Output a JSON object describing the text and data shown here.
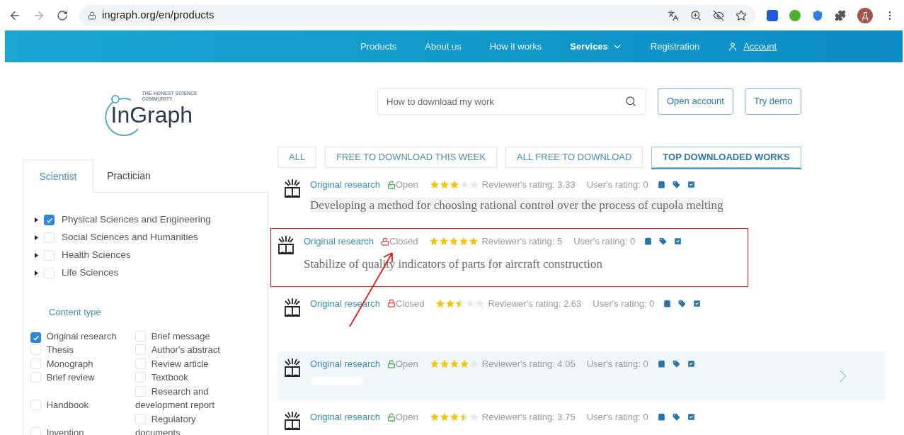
{
  "browser": {
    "url": "ingraph.org/en/products",
    "profile_letter": "Д"
  },
  "nav": {
    "items": [
      {
        "label": "Products",
        "kind": "link",
        "selected": false
      },
      {
        "label": "About us",
        "kind": "link",
        "selected": false
      },
      {
        "label": "How it works",
        "kind": "link",
        "selected": false
      },
      {
        "label": "Services",
        "kind": "dropdown",
        "selected": true
      },
      {
        "label": "Registration",
        "kind": "link",
        "selected": false
      },
      {
        "label": "Account",
        "kind": "account",
        "selected": false
      }
    ]
  },
  "logo": {
    "tagline": "THE HONEST SCIENCE COMMUNITY",
    "name": "InGraph"
  },
  "search": {
    "placeholder": "How to download my work"
  },
  "header_buttons": [
    "Open account",
    "Try demo"
  ],
  "filters": [
    {
      "label": "ALL",
      "selected": false
    },
    {
      "label": "FREE TO DOWNLOAD THIS WEEK",
      "selected": false
    },
    {
      "label": "ALL FREE TO DOWNLOAD",
      "selected": false
    },
    {
      "label": "TOP DOWNLOADED WORKS",
      "selected": true
    }
  ],
  "sidebar": {
    "tabs": [
      {
        "label": "Scientist",
        "selected": true
      },
      {
        "label": "Practician",
        "selected": false
      }
    ],
    "categories": [
      {
        "label": "Physical Sciences and Engineering",
        "checked": true
      },
      {
        "label": "Social Sciences and Humanities",
        "checked": false
      },
      {
        "label": "Health Sciences",
        "checked": false
      },
      {
        "label": "Life Sciences",
        "checked": false
      }
    ],
    "content_type_title": "Content type",
    "content_types": [
      {
        "label": "Original research",
        "checked": true
      },
      {
        "label": "Brief message",
        "checked": false
      },
      {
        "label": "Thesis",
        "checked": false
      },
      {
        "label": "Author's abstract",
        "checked": false
      },
      {
        "label": "Monograph",
        "checked": false
      },
      {
        "label": "Review article",
        "checked": false
      },
      {
        "label": "Brief review",
        "checked": false
      },
      {
        "label": "Textbook",
        "checked": false
      },
      {
        "label": "Handbook",
        "checked": false
      },
      {
        "label": "Research and development report",
        "checked": false
      },
      {
        "label": "Invention",
        "checked": false
      },
      {
        "label": "Regulatory documents",
        "checked": false
      }
    ]
  },
  "works": [
    {
      "type": "Original research",
      "locked": false,
      "access_label": "Open",
      "stars": 3,
      "reviewer_rating": "Reviewer's rating: 3.33",
      "user_rating": "User's rating: 0",
      "title": "Developing a method for choosing rational control over the process of cupola melting",
      "framed": false,
      "hovered": false
    },
    {
      "type": "Original research",
      "locked": true,
      "access_label": "Closed",
      "stars": 5,
      "reviewer_rating": "Reviewer's rating: 5",
      "user_rating": "User's rating: 0",
      "title": "Stabilize of quality indicators of parts for aircraft construction",
      "framed": true,
      "hovered": false
    },
    {
      "type": "Original research",
      "locked": true,
      "access_label": "Closed",
      "stars": 2.5,
      "reviewer_rating": "Reviewer's rating: 2.63",
      "user_rating": "User's rating: 0",
      "framed": false,
      "hovered": false
    },
    {
      "type": "Original research",
      "locked": false,
      "access_label": "Open",
      "stars": 4,
      "reviewer_rating": "Reviewer's rating: 4.05",
      "user_rating": "User's rating: 0",
      "framed": false,
      "hovered": true
    },
    {
      "type": "Original research",
      "locked": false,
      "access_label": "Open",
      "stars": 3.5,
      "reviewer_rating": "Reviewer's rating: 3.75",
      "user_rating": "User's rating: 0",
      "framed": false,
      "hovered": false
    }
  ]
}
